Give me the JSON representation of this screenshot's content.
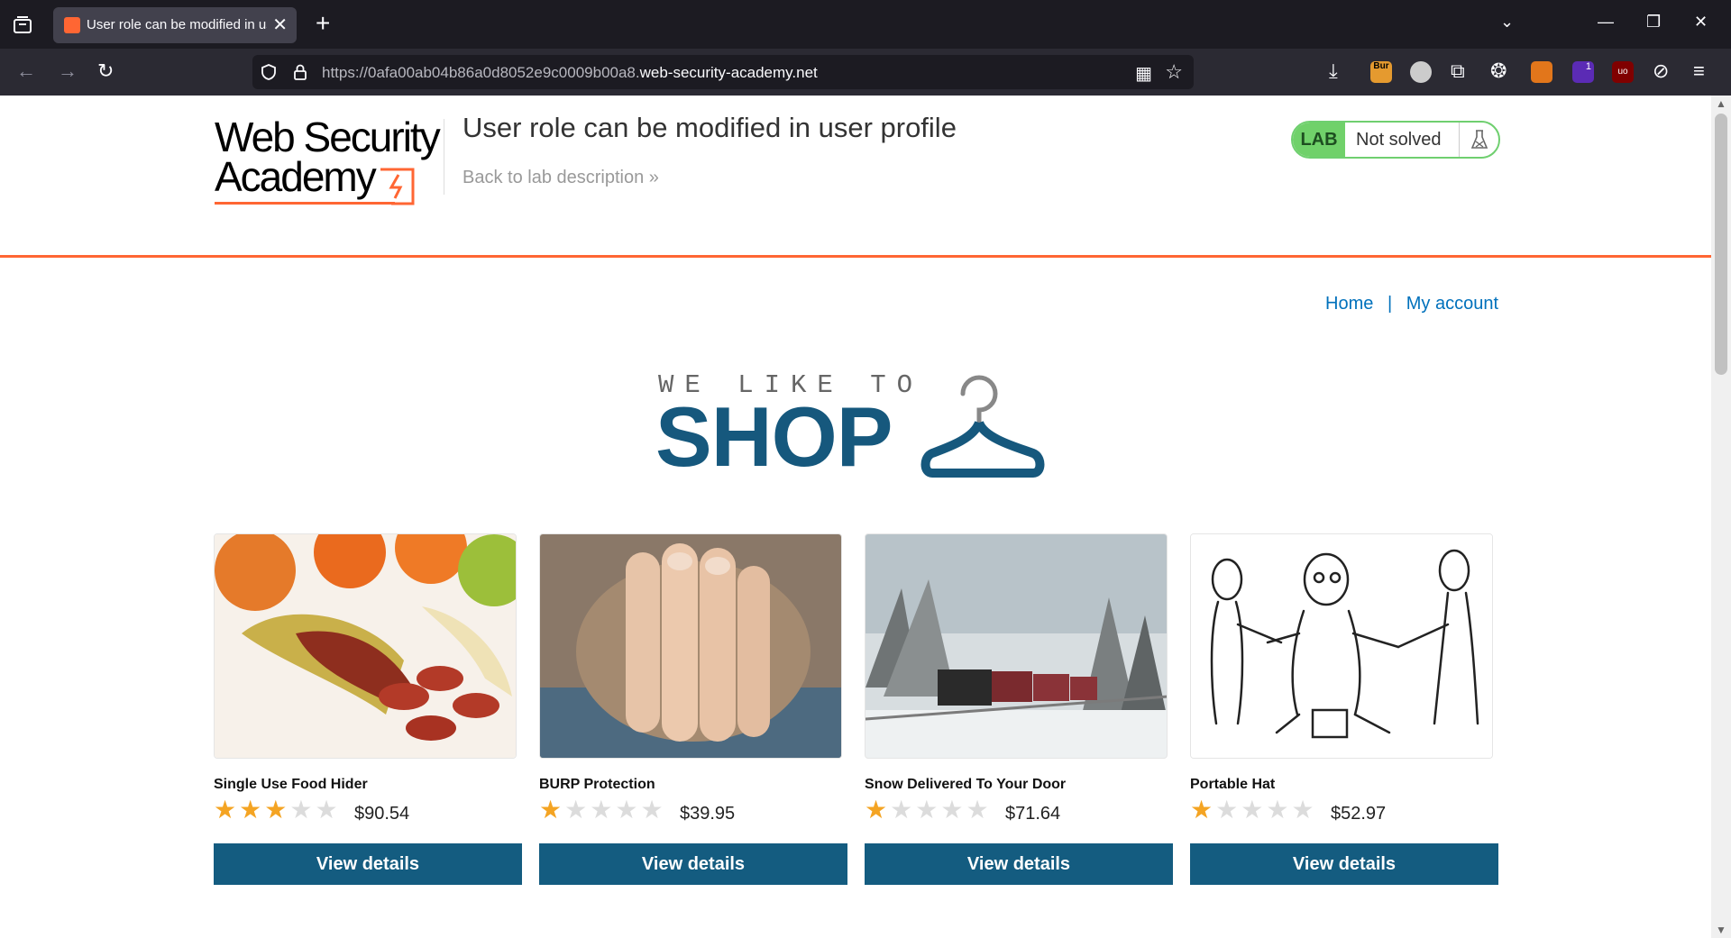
{
  "browser": {
    "tab_title": "User role can be modified in user profile",
    "new_tab_symbol": "+",
    "url_prefix": "https://0afa00ab04b86a0d8052e9c0009b00a8.",
    "url_domain": "web-security-academy.net",
    "extensions": [
      "download-icon",
      "burp-icon",
      "spy-icon",
      "puzzle-icon",
      "cookie-icon",
      "fox-icon",
      "badge-icon",
      "ublock-icon",
      "compass-icon",
      "menu-icon"
    ],
    "burp_ext_label": "Bur",
    "badge_count": "1",
    "ublock_label": "uo"
  },
  "header": {
    "logo_line1": "Web Security",
    "logo_line2": "Academy",
    "lab_title": "User role can be modified in user profile",
    "back_link": "Back to lab description",
    "back_link_arrow": "»",
    "lab_label": "LAB",
    "lab_status": "Not solved",
    "accent_color": "#ff6633"
  },
  "nav": {
    "home": "Home",
    "separator": "|",
    "my_account": "My account"
  },
  "hero": {
    "small": "WE LIKE TO",
    "big": "SHOP"
  },
  "products": [
    {
      "name": "Single Use Food Hider",
      "rating": 3,
      "price": "$90.54",
      "button": "View details"
    },
    {
      "name": "BURP Protection",
      "rating": 1,
      "price": "$39.95",
      "button": "View details"
    },
    {
      "name": "Snow Delivered To Your Door",
      "rating": 1,
      "price": "$71.64",
      "button": "View details"
    },
    {
      "name": "Portable Hat",
      "rating": 1,
      "price": "$52.97",
      "button": "View details"
    }
  ]
}
